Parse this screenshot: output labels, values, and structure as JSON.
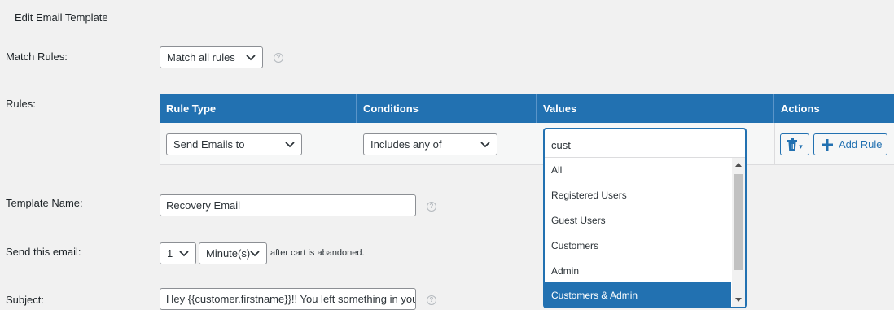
{
  "page": {
    "heading": "Edit Email Template"
  },
  "match_rules": {
    "label": "Match Rules:",
    "value": "Match all rules",
    "help": "?"
  },
  "rules": {
    "label": "Rules:",
    "columns": [
      "Rule Type",
      "Conditions",
      "Values",
      "Actions"
    ],
    "row": {
      "rule_type": "Send Emails to",
      "condition": "Includes any of",
      "values_search": "cust",
      "value_options": [
        "All",
        "Registered Users",
        "Guest Users",
        "Customers",
        "Admin",
        "Customers & Admin"
      ],
      "selected_option": "Customers & Admin"
    },
    "add_rule_label": "Add Rule"
  },
  "template_name": {
    "label": "Template Name:",
    "value": "Recovery Email",
    "help": "?"
  },
  "send_email": {
    "label": "Send this email:",
    "amount": "1",
    "unit": "Minute(s)",
    "suffix": "after cart is abandoned."
  },
  "subject": {
    "label": "Subject:",
    "value": "Hey {{customer.firstname}}!! You left something in your cart",
    "help": "?"
  },
  "colors": {
    "accent": "#2271b1",
    "background": "#f1f1f1"
  }
}
